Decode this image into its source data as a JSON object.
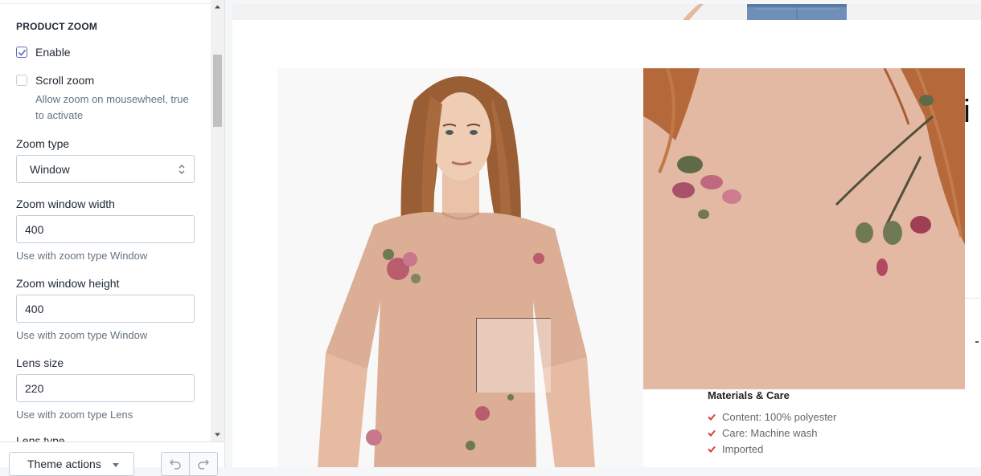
{
  "settings": {
    "section_title": "PRODUCT ZOOM",
    "enable": {
      "label": "Enable",
      "checked": true
    },
    "scroll_zoom": {
      "label": "Scroll zoom",
      "checked": false,
      "help": "Allow zoom on mousewheel, true to activate"
    },
    "zoom_type": {
      "label": "Zoom type",
      "value": "Window"
    },
    "zoom_window_width": {
      "label": "Zoom window width",
      "value": "400",
      "help": "Use with zoom type Window"
    },
    "zoom_window_height": {
      "label": "Zoom window height",
      "value": "400",
      "help": "Use with zoom type Window"
    },
    "lens_size": {
      "label": "Lens size",
      "value": "220",
      "help": "Use with zoom type Lens"
    },
    "lens_type": {
      "label": "Lens type"
    }
  },
  "footer": {
    "theme_actions_label": "Theme actions",
    "undo_icon": "undo-icon",
    "redo_icon": "redo-icon"
  },
  "preview": {
    "title_fragment": "i",
    "materials": {
      "title": "Materials & Care",
      "items": [
        "Content: 100% polyester",
        "Care: Machine wash",
        "Imported"
      ]
    }
  },
  "colors": {
    "accent": "#5c6ac4",
    "check_red": "#e0383e",
    "shirt": "#dcae95",
    "hair": "#9a5e35"
  }
}
